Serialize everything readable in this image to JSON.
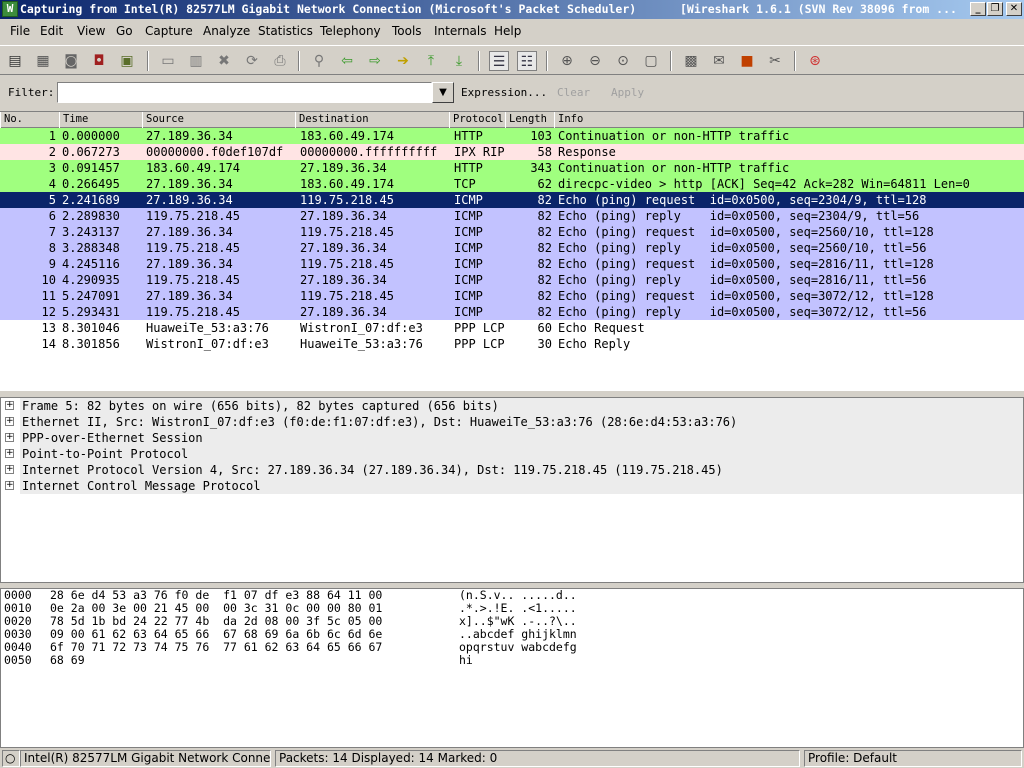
{
  "window": {
    "title": "Capturing from Intel(R) 82577LM Gigabit Network Connection (Microsoft's Packet Scheduler)",
    "title_right": "[Wireshark 1.6.1  (SVN Rev 38096 from ...",
    "controls": {
      "minimize": "_",
      "restore": "❐",
      "close": "✕"
    }
  },
  "menu": [
    "File",
    "Edit",
    "View",
    "Go",
    "Capture",
    "Analyze",
    "Statistics",
    "Telephony",
    "Tools",
    "Internals",
    "Help"
  ],
  "filter": {
    "label": "Filter:",
    "value": "",
    "expression": "Expression...",
    "clear": "Clear",
    "apply": "Apply"
  },
  "columns": [
    "No.",
    "Time",
    "Source",
    "Destination",
    "Protocol",
    "Length",
    "Info"
  ],
  "packets": [
    {
      "no": "1",
      "time": "0.000000",
      "src": "27.189.36.34",
      "dst": "183.60.49.174",
      "proto": "HTTP",
      "len": "103",
      "info": "Continuation or non-HTTP traffic",
      "color": "#a0ff7f"
    },
    {
      "no": "2",
      "time": "0.067273",
      "src": "00000000.f0def107df",
      "dst": "00000000.ffffffffff",
      "proto": "IPX RIP",
      "len": "58",
      "info": "Response",
      "color": "#ffe4e4"
    },
    {
      "no": "3",
      "time": "0.091457",
      "src": "183.60.49.174",
      "dst": "27.189.36.34",
      "proto": "HTTP",
      "len": "343",
      "info": "Continuation or non-HTTP traffic",
      "color": "#a0ff7f"
    },
    {
      "no": "4",
      "time": "0.266495",
      "src": "27.189.36.34",
      "dst": "183.60.49.174",
      "proto": "TCP",
      "len": "62",
      "info": "direcpc-video > http [ACK] Seq=42 Ack=282 Win=64811 Len=0",
      "color": "#a0ff7f"
    },
    {
      "no": "5",
      "time": "2.241689",
      "src": "27.189.36.34",
      "dst": "119.75.218.45",
      "proto": "ICMP",
      "len": "82",
      "info": "Echo (ping) request  id=0x0500, seq=2304/9, ttl=128",
      "color": "#0a246a",
      "selected": true
    },
    {
      "no": "6",
      "time": "2.289830",
      "src": "119.75.218.45",
      "dst": "27.189.36.34",
      "proto": "ICMP",
      "len": "82",
      "info": "Echo (ping) reply    id=0x0500, seq=2304/9, ttl=56",
      "color": "#c2c2ff"
    },
    {
      "no": "7",
      "time": "3.243137",
      "src": "27.189.36.34",
      "dst": "119.75.218.45",
      "proto": "ICMP",
      "len": "82",
      "info": "Echo (ping) request  id=0x0500, seq=2560/10, ttl=128",
      "color": "#c2c2ff"
    },
    {
      "no": "8",
      "time": "3.288348",
      "src": "119.75.218.45",
      "dst": "27.189.36.34",
      "proto": "ICMP",
      "len": "82",
      "info": "Echo (ping) reply    id=0x0500, seq=2560/10, ttl=56",
      "color": "#c2c2ff"
    },
    {
      "no": "9",
      "time": "4.245116",
      "src": "27.189.36.34",
      "dst": "119.75.218.45",
      "proto": "ICMP",
      "len": "82",
      "info": "Echo (ping) request  id=0x0500, seq=2816/11, ttl=128",
      "color": "#c2c2ff"
    },
    {
      "no": "10",
      "time": "4.290935",
      "src": "119.75.218.45",
      "dst": "27.189.36.34",
      "proto": "ICMP",
      "len": "82",
      "info": "Echo (ping) reply    id=0x0500, seq=2816/11, ttl=56",
      "color": "#c2c2ff"
    },
    {
      "no": "11",
      "time": "5.247091",
      "src": "27.189.36.34",
      "dst": "119.75.218.45",
      "proto": "ICMP",
      "len": "82",
      "info": "Echo (ping) request  id=0x0500, seq=3072/12, ttl=128",
      "color": "#c2c2ff"
    },
    {
      "no": "12",
      "time": "5.293431",
      "src": "119.75.218.45",
      "dst": "27.189.36.34",
      "proto": "ICMP",
      "len": "82",
      "info": "Echo (ping) reply    id=0x0500, seq=3072/12, ttl=56",
      "color": "#c2c2ff"
    },
    {
      "no": "13",
      "time": "8.301046",
      "src": "HuaweiTe_53:a3:76",
      "dst": "WistronI_07:df:e3",
      "proto": "PPP LCP",
      "len": "60",
      "info": "Echo Request",
      "color": "#ffffff"
    },
    {
      "no": "14",
      "time": "8.301856",
      "src": "WistronI_07:df:e3",
      "dst": "HuaweiTe_53:a3:76",
      "proto": "PPP LCP",
      "len": "30",
      "info": "Echo Reply",
      "color": "#ffffff"
    }
  ],
  "details": [
    "Frame 5: 82 bytes on wire (656 bits), 82 bytes captured (656 bits)",
    "Ethernet II, Src: WistronI_07:df:e3 (f0:de:f1:07:df:e3), Dst: HuaweiTe_53:a3:76 (28:6e:d4:53:a3:76)",
    "PPP-over-Ethernet Session",
    "Point-to-Point Protocol",
    "Internet Protocol Version 4, Src: 27.189.36.34 (27.189.36.34), Dst: 119.75.218.45 (119.75.218.45)",
    "Internet Control Message Protocol"
  ],
  "hex": [
    {
      "off": "0000",
      "bytes": "28 6e d4 53 a3 76 f0 de  f1 07 df e3 88 64 11 00",
      "ascii": "(n.S.v.. .....d.."
    },
    {
      "off": "0010",
      "bytes": "0e 2a 00 3e 00 21 45 00  00 3c 31 0c 00 00 80 01",
      "ascii": ".*.>.!E. .<1....."
    },
    {
      "off": "0020",
      "bytes": "78 5d 1b bd 24 22 77 4b  da 2d 08 00 3f 5c 05 00",
      "ascii": "x]..$\"wK .-..?\\.."
    },
    {
      "off": "0030",
      "bytes": "09 00 61 62 63 64 65 66  67 68 69 6a 6b 6c 6d 6e",
      "ascii": "..abcdef ghijklmn"
    },
    {
      "off": "0040",
      "bytes": "6f 70 71 72 73 74 75 76  77 61 62 63 64 65 66 67",
      "ascii": "opqrstuv wabcdefg"
    },
    {
      "off": "0050",
      "bytes": "68 69",
      "ascii": "hi"
    }
  ],
  "status": {
    "interface": "Intel(R) 82577LM Gigabit Network Conne...",
    "packets": "Packets: 14 Displayed: 14 Marked: 0",
    "profile": "Profile: Default"
  }
}
